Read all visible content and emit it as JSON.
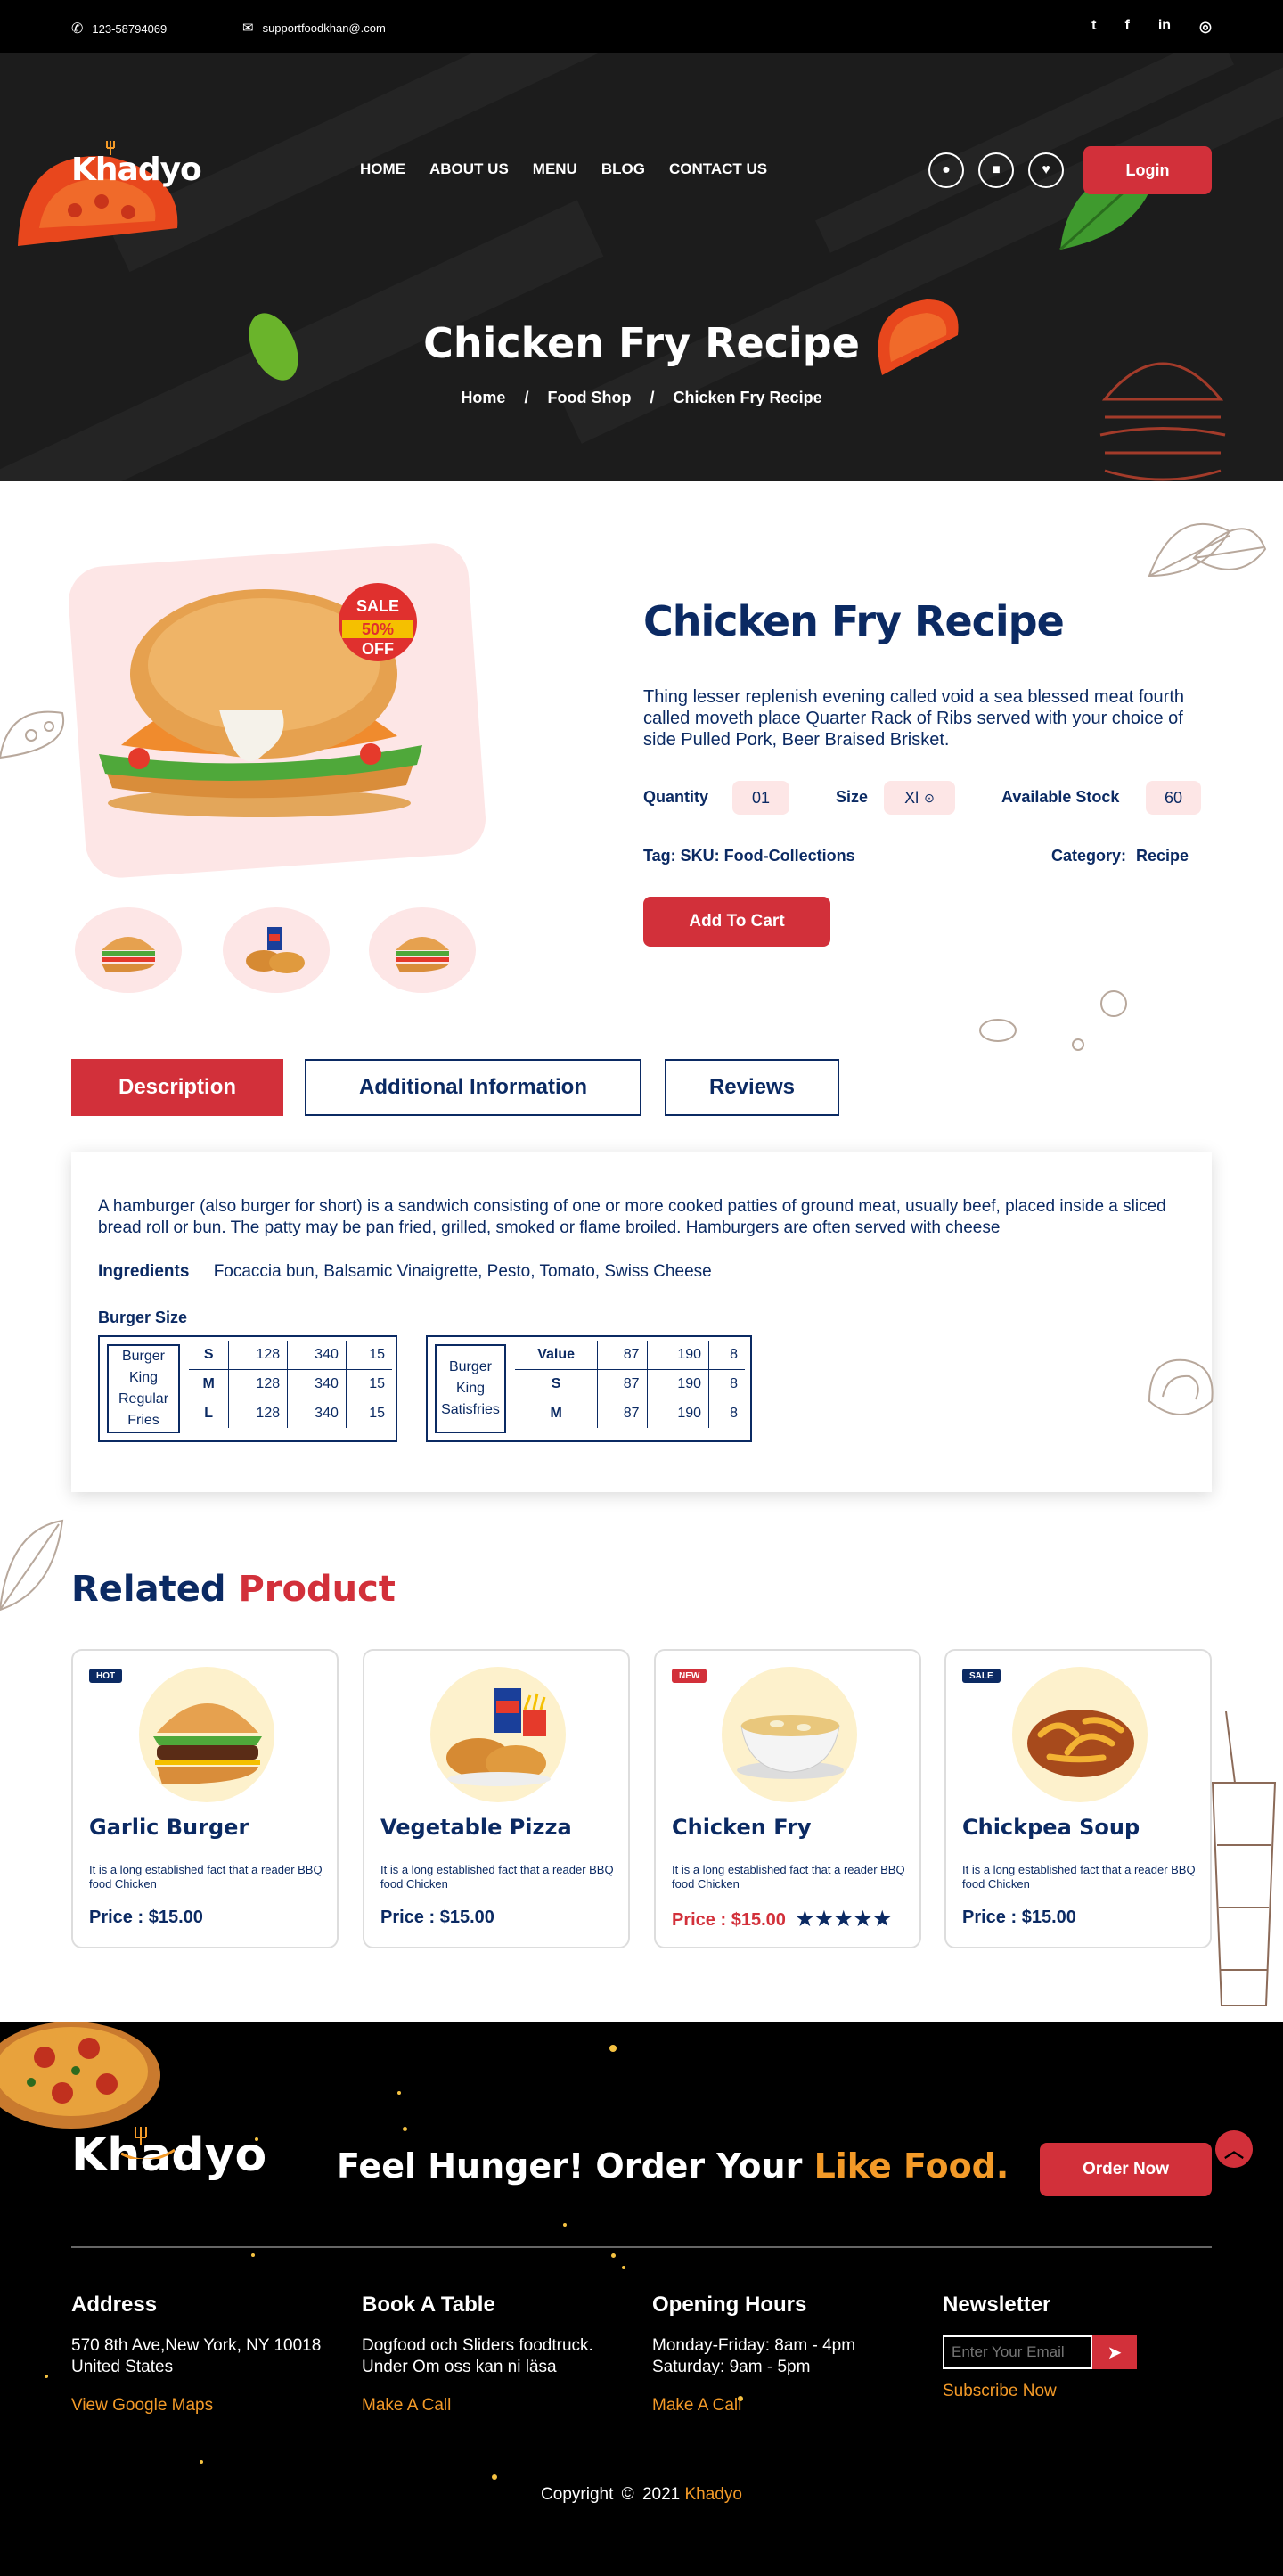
{
  "topbar": {
    "phone": "123-58794069",
    "email": "supportfoodkhan@.com",
    "social": [
      "twitter-icon",
      "facebook-icon",
      "linkedin-icon",
      "instagram-icon"
    ]
  },
  "brand": {
    "logo": "Khadyo"
  },
  "nav": [
    "HOME",
    "ABOUT US",
    "MENU",
    "BLOG",
    "CONTACT US"
  ],
  "header_icons": [
    "user-icon",
    "bag-icon",
    "heart-icon"
  ],
  "login_label": "Login",
  "hero": {
    "title": "Chicken Fry Recipe",
    "breadcrumb": [
      "Home",
      "Food Shop",
      "Chicken Fry Recipe"
    ],
    "sep": "/"
  },
  "product": {
    "title": "Chicken Fry Recipe",
    "description": "Thing lesser replenish evening called void a sea blessed meat fourth called moveth place Quarter Rack of Ribs served with your choice of side Pulled Pork, Beer Braised Brisket.",
    "sale_badge": [
      "SALE",
      "50%",
      "OFF"
    ],
    "quantity_label": "Quantity",
    "quantity": "01",
    "size_label": "Size",
    "size": "Xl",
    "stock_label": "Available Stock",
    "stock": "60",
    "tag_label": "Tag: SKU: Food-Collections",
    "category_label": "Category:",
    "category": "Recipe",
    "add_to_cart": "Add  To Cart"
  },
  "tabs": [
    "Description",
    "Additional Information",
    "Reviews"
  ],
  "description": {
    "text": "A hamburger (also burger for short) is a sandwich consisting of one or more cooked patties of ground meat, usually beef, placed inside a sliced bread roll or bun. The patty may be pan fried, grilled, smoked or flame broiled. Hamburgers are often served with cheese",
    "ingredients_label": "Ingredients",
    "ingredients": "Focaccia bun, Balsamic Vinaigrette, Pesto, Tomato, Swiss Cheese",
    "size_heading": "Burger Size",
    "table1": {
      "name": "Burger King Regular Fries",
      "rows": [
        [
          "S",
          "128",
          "340",
          "15"
        ],
        [
          "M",
          "128",
          "340",
          "15"
        ],
        [
          "L",
          "128",
          "340",
          "15"
        ]
      ]
    },
    "table2": {
      "name": "Burger King Satisfries",
      "rows": [
        [
          "Value",
          "87",
          "190",
          "8"
        ],
        [
          "S",
          "87",
          "190",
          "8"
        ],
        [
          "M",
          "87",
          "190",
          "8"
        ]
      ]
    }
  },
  "related": {
    "title_a": "Related",
    "title_b": "Product",
    "items": [
      {
        "badge": "HOT",
        "badge_color": "#0b2a63",
        "title": "Garlic Burger",
        "text": "It is a long established fact that  a reader BBQ food Chicken",
        "price": "Price : $15.00",
        "stars": ""
      },
      {
        "badge": "",
        "badge_color": "",
        "title": "Vegetable Pizza",
        "text": "It is a long established fact that  a reader BBQ food Chicken",
        "price": "Price : $15.00",
        "stars": ""
      },
      {
        "badge": "NEW",
        "badge_color": "#d2303a",
        "title": "Chicken Fry",
        "text": "It is a long established fact that  a reader BBQ food Chicken",
        "price": "Price : $15.00",
        "stars": "★★★★★"
      },
      {
        "badge": "SALE",
        "badge_color": "#0b2a63",
        "title": "Chickpea Soup",
        "text": "It is a long established fact that  a reader BBQ food Chicken",
        "price": "Price : $15.00",
        "stars": ""
      }
    ]
  },
  "footer": {
    "logo": "Khadyo",
    "slogan_a": "Feel Hunger! Order Your",
    "slogan_b": "Like Food.",
    "order_now": "Order Now",
    "address": {
      "title": "Address",
      "line1": "570 8th Ave,New York, NY 10018",
      "line2": "United States",
      "link": "View Google Maps"
    },
    "table": {
      "title": "Book A Table",
      "line1": "Dogfood och Sliders foodtruck.",
      "line2": "Under Om oss kan ni läsa",
      "link": "Make A Call"
    },
    "hours": {
      "title": "Opening Hours",
      "line1": "Monday-Friday: 8am - 4pm",
      "line2": "Saturday: 9am - 5pm",
      "link": "Make A Call"
    },
    "newsletter": {
      "title": "Newsletter",
      "placeholder": "Enter Your Email",
      "link": "Subscribe Now"
    },
    "copyright_a": "Copyright",
    "copyright_year": "2021",
    "copyright_brand": "Khadyo"
  },
  "colors": {
    "navy": "#0b2a63",
    "red": "#d2303a",
    "orange": "#f39a28",
    "pink": "#fde6e6"
  }
}
